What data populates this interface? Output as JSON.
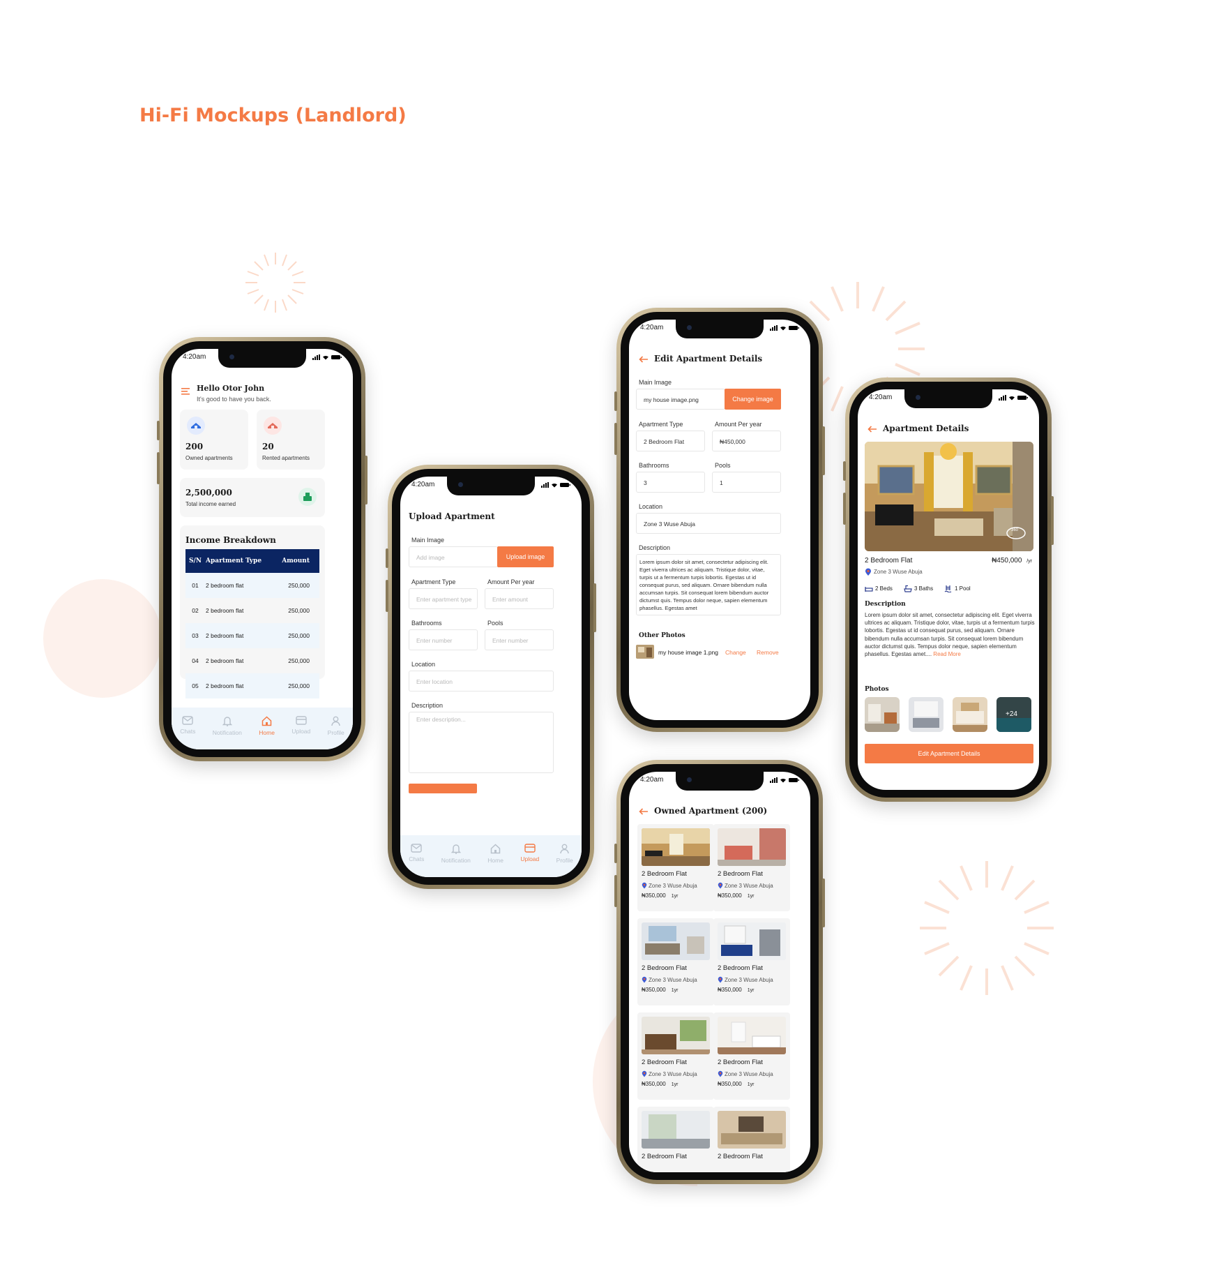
{
  "page_title": "Hi-Fi Mockups (Landlord)",
  "colors": {
    "accent": "#f47a45",
    "navy": "#0b2562",
    "tabbar": "#eef5fb"
  },
  "status_time": "4:20am",
  "tabs": [
    "Chats",
    "Notification",
    "Home",
    "Upload",
    "Profile"
  ],
  "home": {
    "greeting": "Hello Otor John",
    "subgreeting": "It's good to have you back.",
    "owned_count": "200",
    "owned_label": "Owned apartments",
    "rented_count": "20",
    "rented_label": "Rented apartments",
    "income": "2,500,000",
    "income_label": "Total income earned",
    "breakdown_title": "Income Breakdown",
    "table_headers": [
      "S/N",
      "Apartment Type",
      "Amount"
    ],
    "table_rows": [
      [
        "01",
        "2 bedroom flat",
        "250,000"
      ],
      [
        "02",
        "2 bedroom flat",
        "250,000"
      ],
      [
        "03",
        "2 bedroom flat",
        "250,000"
      ],
      [
        "04",
        "2 bedroom flat",
        "250,000"
      ],
      [
        "05",
        "2 bedroom flat",
        "250,000"
      ]
    ]
  },
  "upload": {
    "title": "Upload Apartment",
    "main_image_label": "Main Image",
    "main_image_placeholder": "Add image",
    "upload_button": "Upload image",
    "type_label": "Apartment Type",
    "type_placeholder": "Enter apartment type",
    "amount_label": "Amount Per year",
    "amount_placeholder": "Enter amount",
    "bathrooms_label": "Bathrooms",
    "bathrooms_placeholder": "Enter number",
    "pools_label": "Pools",
    "pools_placeholder": "Enter number",
    "location_label": "Location",
    "location_placeholder": "Enter location",
    "description_label": "Description",
    "description_placeholder": "Enter description..."
  },
  "edit": {
    "title": "Edit Apartment Details",
    "main_image_label": "Main Image",
    "main_image_value": "my house image.png",
    "change_image_button": "Change image",
    "type_label": "Apartment Type",
    "type_value": "2 Bedroom Flat",
    "amount_label": "Amount Per year",
    "amount_value": "₦450,000",
    "bathrooms_label": "Bathrooms",
    "bathrooms_value": "3",
    "pools_label": "Pools",
    "pools_value": "1",
    "location_label": "Location",
    "location_value": "Zone 3 Wuse Abuja",
    "description_label": "Description",
    "description_value": "Lorem ipsum dolor sit amet, consectetur adipiscing elit. Eget viverra ultrices ac aliquam. Tristique dolor, vitae, turpis ut a fermentum turpis lobortis. Egestas ut id consequat purus, sed aliquam. Ornare bibendum nulla accumsan turpis. Sit consequat lorem bibendum auctor dictumst quis. Tempus dolor neque, sapien elementum phasellus. Egestas amet",
    "other_photos_label": "Other Photos",
    "other_photo_name": "my house image 1.png",
    "change_link": "Change",
    "remove_link": "Remove"
  },
  "details": {
    "title": "Apartment Details",
    "badge_360": "360",
    "name": "2 Bedroom Flat",
    "price": "₦450,000",
    "per": "/yr",
    "location": "Zone 3 Wuse Abuja",
    "beds": "2 Beds",
    "baths": "3 Baths",
    "pool": "1 Pool",
    "description_label": "Description",
    "description": "Lorem ipsum dolor sit amet, consectetur adipiscing elit. Eget viverra ultrices ac aliquam. Tristique dolor, vitae, turpis ut a fermentum turpis lobortis. Egestas ut id consequat purus, sed aliquam. Ornare bibendum nulla accumsan turpis. Sit consequat lorem bibendum auctor dictumst quis. Tempus dolor neque, sapien elementum phasellus. Egestas amet....",
    "read_more": "Read More",
    "photos_label": "Photos",
    "more_photos": "+24",
    "edit_button": "Edit Apartment Details"
  },
  "owned": {
    "title": "Owned Apartment (200)",
    "item_title": "2 Bedroom Flat",
    "item_location": "Zone 3 Wuse Abuja",
    "item_price": "₦350,000",
    "item_per": "1yr"
  }
}
